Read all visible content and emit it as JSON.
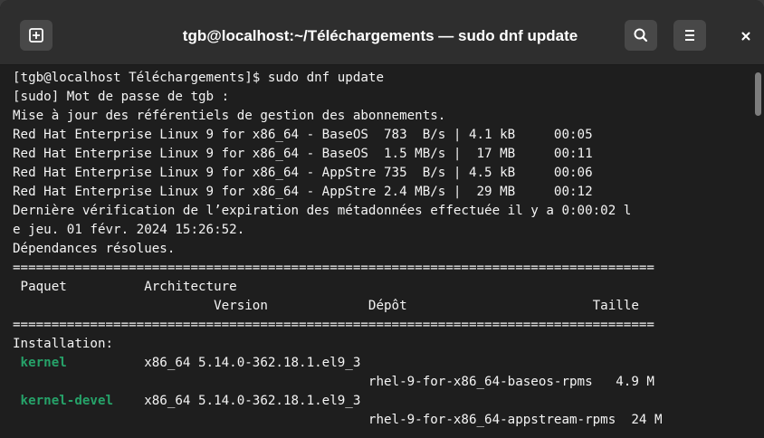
{
  "window": {
    "title": "tgb@localhost:~/Téléchargements — sudo dnf update",
    "icons": {
      "new_tab": "new-tab-icon",
      "search": "search-icon",
      "menu": "hamburger-menu-icon",
      "close": "close-icon"
    }
  },
  "terminal": {
    "lines": [
      "[tgb@localhost Téléchargements]$ sudo dnf update",
      "[sudo] Mot de passe de tgb :",
      "Mise à jour des référentiels de gestion des abonnements.",
      "Red Hat Enterprise Linux 9 for x86_64 - BaseOS  783  B/s | 4.1 kB     00:05",
      "Red Hat Enterprise Linux 9 for x86_64 - BaseOS  1.5 MB/s |  17 MB     00:11",
      "Red Hat Enterprise Linux 9 for x86_64 - AppStre 735  B/s | 4.5 kB     00:06",
      "Red Hat Enterprise Linux 9 for x86_64 - AppStre 2.4 MB/s |  29 MB     00:12",
      "Dernière vérification de l’expiration des métadonnées effectuée il y a 0:00:02 l",
      "e jeu. 01 févr. 2024 15:26:52.",
      "Dépendances résolues.",
      "===================================================================================",
      " Paquet          Architecture",
      "                          Version             Dépôt                        Taille",
      "===================================================================================",
      "Installation:",
      "                 x86_64 5.14.0-362.18.1.el9_3",
      "                                              rhel-9-for-x86_64-baseos-rpms   4.9 M",
      "                 x86_64 5.14.0-362.18.1.el9_3",
      "                                              rhel-9-for-x86_64-appstream-rpms  24 M"
    ],
    "packages": [
      {
        "name": " kernel"
      },
      {
        "name": " kernel-devel"
      }
    ]
  },
  "colors": {
    "terminal_bg": "#1e1e1e",
    "text": "#f4f4f4",
    "package_green": "#26a269",
    "headerbar": "#2e2e2e"
  }
}
